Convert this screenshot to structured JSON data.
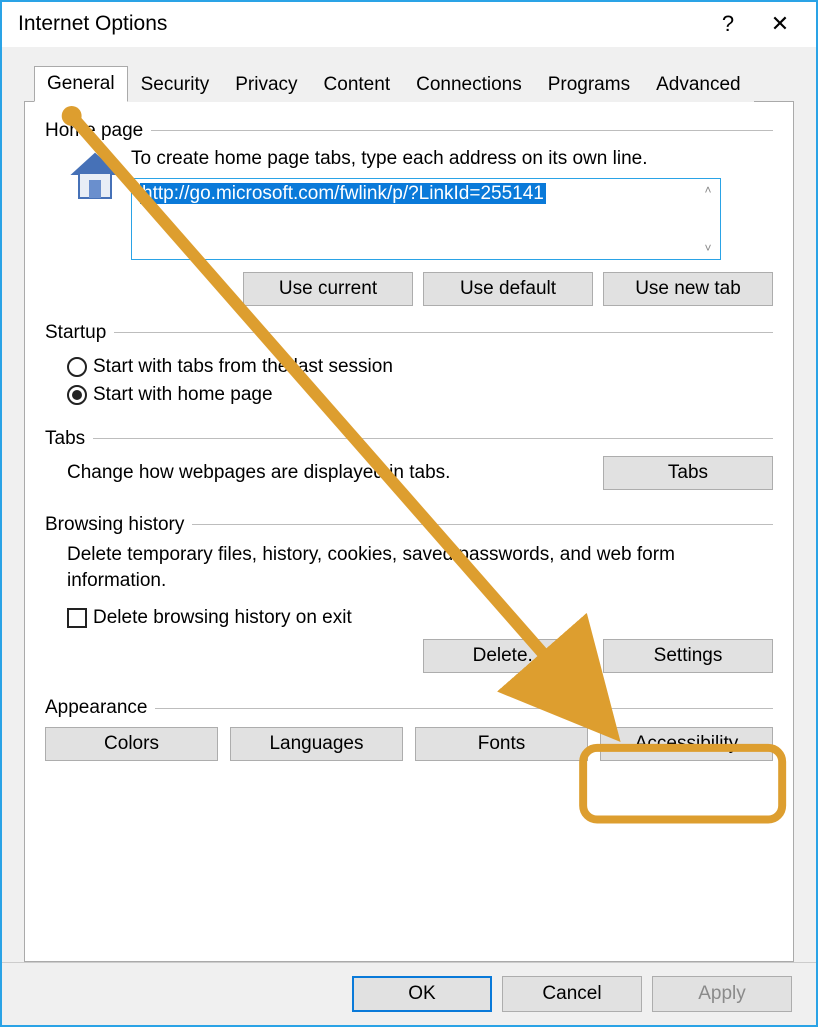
{
  "window": {
    "title": "Internet Options",
    "help_icon": "?",
    "close_icon": "✕"
  },
  "tabs": {
    "items": [
      "General",
      "Security",
      "Privacy",
      "Content",
      "Connections",
      "Programs",
      "Advanced"
    ],
    "active": "General"
  },
  "home_page": {
    "group_label": "Home page",
    "instruction": "To create home page tabs, type each address on its own line.",
    "address": "http://go.microsoft.com/fwlink/p/?LinkId=255141",
    "btn_use_current": "Use current",
    "btn_use_default": "Use default",
    "btn_use_new_tab": "Use new tab"
  },
  "startup": {
    "group_label": "Startup",
    "option_last_session": "Start with tabs from the last session",
    "option_home_page": "Start with home page",
    "selected": "home_page"
  },
  "tabs_group": {
    "group_label": "Tabs",
    "desc": "Change how webpages are displayed in tabs.",
    "btn_tabs": "Tabs"
  },
  "history": {
    "group_label": "Browsing history",
    "desc": "Delete temporary files, history, cookies, saved passwords, and web form information.",
    "checkbox_label": "Delete browsing history on exit",
    "checkbox_checked": false,
    "btn_delete": "Delete...",
    "btn_settings": "Settings"
  },
  "appearance": {
    "group_label": "Appearance",
    "btn_colors": "Colors",
    "btn_languages": "Languages",
    "btn_fonts": "Fonts",
    "btn_accessibility": "Accessibility"
  },
  "footer": {
    "ok": "OK",
    "cancel": "Cancel",
    "apply": "Apply"
  },
  "annotation": {
    "highlight_target": "settings-button",
    "color": "#dd9e2f"
  }
}
